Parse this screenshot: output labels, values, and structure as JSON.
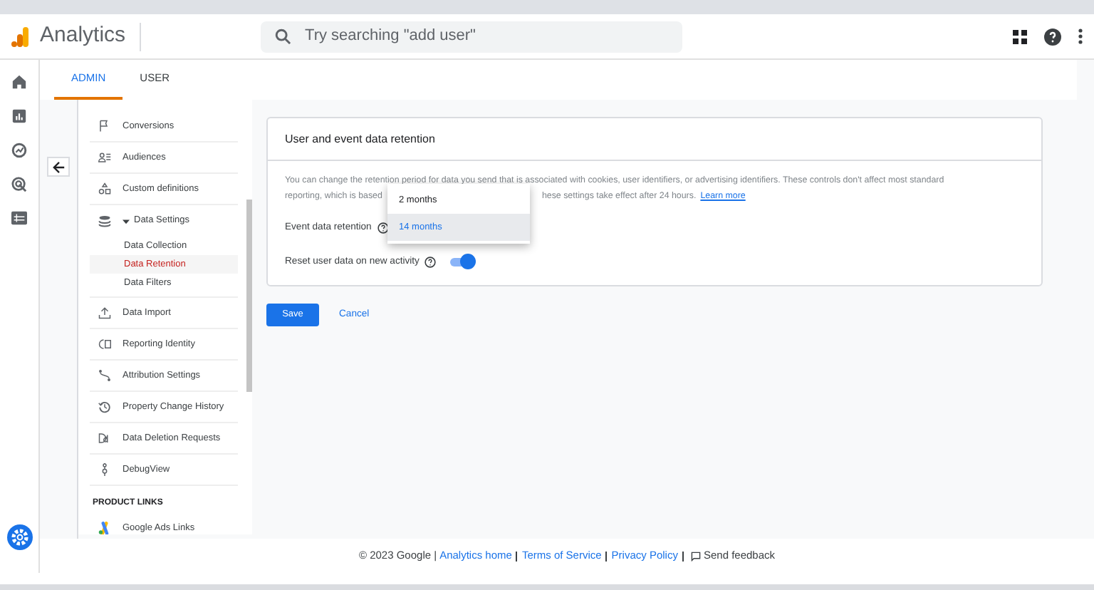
{
  "header": {
    "app_name": "Analytics",
    "search": {
      "placeholder": "Try searching \"add user\""
    }
  },
  "tabs": [
    {
      "label": "ADMIN",
      "selected": true
    },
    {
      "label": "USER",
      "selected": false
    }
  ],
  "nav": [
    {
      "kind": "item",
      "label": "Conversions",
      "selected": false
    },
    {
      "kind": "item",
      "label": "Audiences",
      "selected": false
    },
    {
      "kind": "item",
      "label": "Custom definitions",
      "selected": false
    },
    {
      "kind": "group",
      "label": "Data Settings",
      "expanded": true,
      "children": [
        {
          "label": "Data Collection",
          "selected": false
        },
        {
          "label": "Data Retention",
          "selected": true
        },
        {
          "label": "Data Filters",
          "selected": false
        }
      ]
    },
    {
      "kind": "item",
      "label": "Data Import",
      "selected": false
    },
    {
      "kind": "item",
      "label": "Reporting Identity",
      "selected": false
    },
    {
      "kind": "item",
      "label": "Attribution Settings",
      "selected": false
    },
    {
      "kind": "item",
      "label": "Property Change History",
      "selected": false
    },
    {
      "kind": "item",
      "label": "Data Deletion Requests",
      "selected": false
    },
    {
      "kind": "item",
      "label": "DebugView",
      "selected": false
    },
    {
      "kind": "heading",
      "label": "PRODUCT LINKS"
    },
    {
      "kind": "item",
      "label": "Google Ads Links",
      "selected": false
    }
  ],
  "card": {
    "title": "User and event data retention",
    "description_line_1": "You can change the retention period for data you send that is associated with cookies, user identifiers, or advertising identifiers. These controls don't affect most standard",
    "description_line_2_start": "reporting, which is based",
    "description_line_2_end": "hese settings take effect after 24 hours.",
    "learn_more": "Learn more",
    "event_retention_label": "Event data retention",
    "reset_label": "Reset user data on new activity",
    "reset_on": true,
    "dropdown_options": [
      {
        "label": "2 months",
        "selected": false
      },
      {
        "label": "14 months",
        "selected": true
      }
    ]
  },
  "buttons": {
    "save": "Save",
    "cancel": "Cancel"
  },
  "footer": {
    "copyright": "© 2023 Google |",
    "links": [
      "Analytics home",
      "Terms of Service",
      "Privacy Policy"
    ],
    "feedback": "Send feedback"
  }
}
